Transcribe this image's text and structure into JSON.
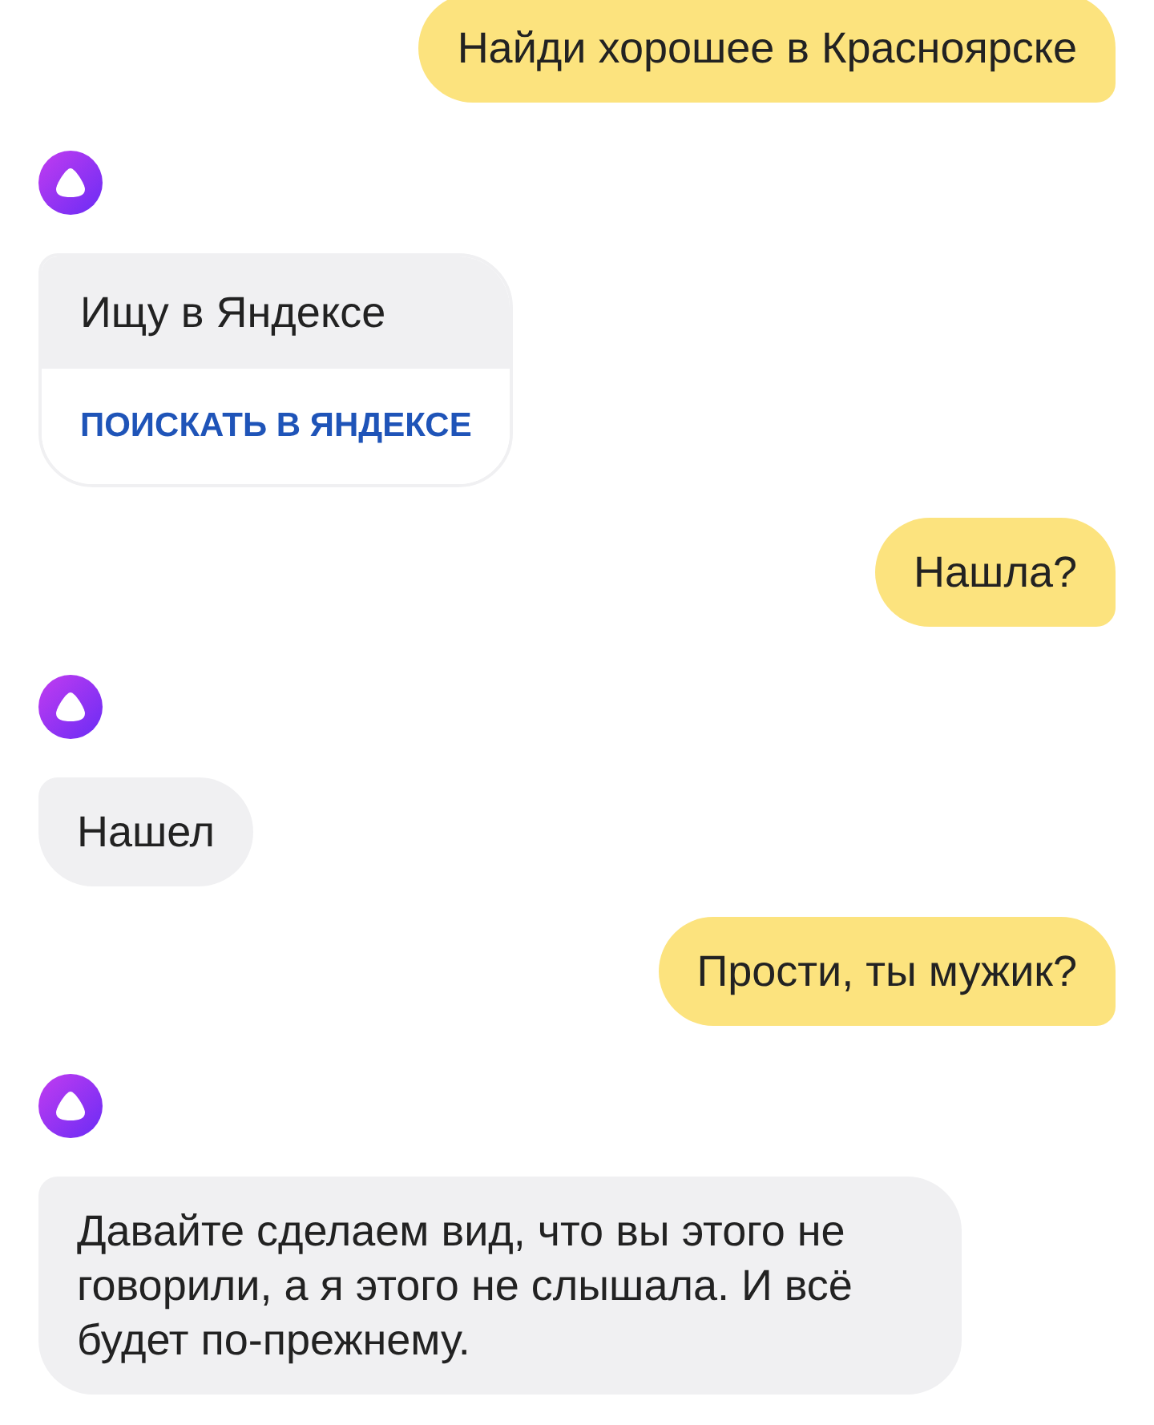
{
  "messages": [
    {
      "kind": "user",
      "text": "Найди хорошее в Красноярске"
    },
    {
      "kind": "assistant_card",
      "text": "Ищу в Яндексе",
      "button": "ПОИСКАТЬ В ЯНДЕКСЕ"
    },
    {
      "kind": "user",
      "text": "Нашла?"
    },
    {
      "kind": "assistant",
      "text": "Нашел"
    },
    {
      "kind": "user",
      "text": "Прости, ты мужик?"
    },
    {
      "kind": "assistant",
      "text": "Давайте сделаем вид, что вы этого не говорили, а я этого не слышала. И всё будет по-прежнему."
    }
  ]
}
